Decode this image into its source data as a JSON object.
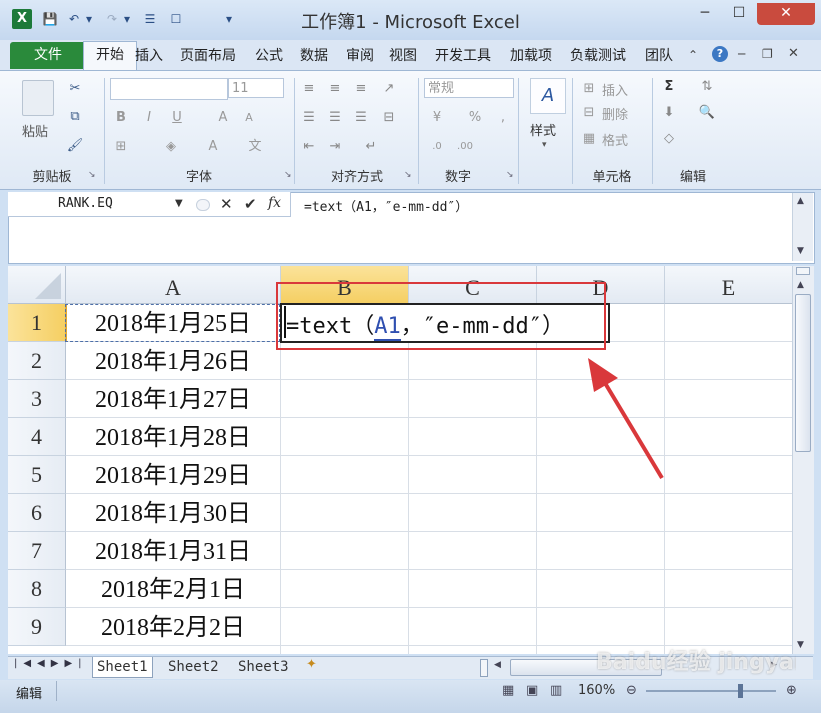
{
  "window": {
    "title": "工作簿1 - Microsoft Excel",
    "controls": [
      "─",
      "☐",
      "✕"
    ]
  },
  "qat": [
    "💾",
    "↶",
    "▾",
    "↷",
    "▾",
    "☰",
    "☐",
    "▾"
  ],
  "tabs": [
    "文件",
    "开始",
    "插入",
    "页面布局",
    "公式",
    "数据",
    "审阅",
    "视图",
    "开发工具",
    "加载项",
    "负载测试",
    "团队"
  ],
  "ribbon": {
    "clipboard": {
      "paste": "粘贴",
      "label": "剪贴板"
    },
    "font": {
      "size": "11",
      "label": "字体",
      "bold": "B",
      "italic": "I",
      "underline": "U"
    },
    "alignment": {
      "label": "对齐方式"
    },
    "number": {
      "format": "常规",
      "label": "数字",
      "percent": "%"
    },
    "styles": {
      "button": "样式"
    },
    "cells": {
      "insert": "插入",
      "delete": "删除",
      "format": "格式",
      "label": "单元格"
    },
    "editing": {
      "label": "编辑",
      "sigma": "Σ"
    }
  },
  "formula_bar": {
    "name_box": "RANK.EQ",
    "fx": "fx",
    "formula": "=text（A1，″e-mm-dd″）"
  },
  "columns": [
    "A",
    "B",
    "C",
    "D",
    "E"
  ],
  "rows": [
    {
      "n": "1",
      "a": "2018年1月25日"
    },
    {
      "n": "2",
      "a": "2018年1月26日"
    },
    {
      "n": "3",
      "a": "2018年1月27日"
    },
    {
      "n": "4",
      "a": "2018年1月28日"
    },
    {
      "n": "5",
      "a": "2018年1月29日"
    },
    {
      "n": "6",
      "a": "2018年1月30日"
    },
    {
      "n": "7",
      "a": "2018年1月31日"
    },
    {
      "n": "8",
      "a": "2018年2月1日"
    },
    {
      "n": "9",
      "a": "2018年2月2日"
    }
  ],
  "active_cell": {
    "formula_prefix": "=text（",
    "ref": "A1",
    "formula_suffix": "，″e-mm-dd″）"
  },
  "sheets": [
    "Sheet1",
    "Sheet2",
    "Sheet3"
  ],
  "status": {
    "mode": "编辑",
    "zoom": "160%"
  },
  "watermark": "Baidu经验 jingyan.baidu.com",
  "annotation_color": "#d9383b"
}
